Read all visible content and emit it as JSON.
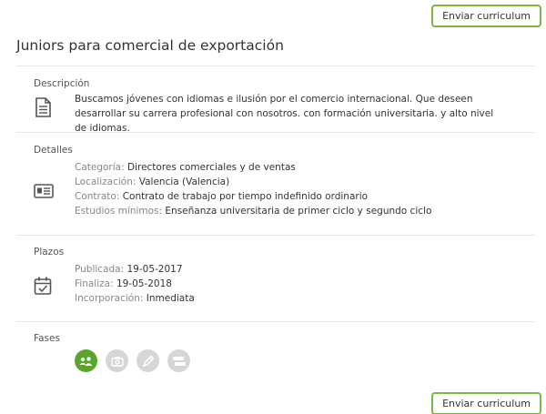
{
  "actions": {
    "send_cv_label": "Enviar curriculum"
  },
  "job": {
    "title": "Juniors para comercial de exportación"
  },
  "description": {
    "label": "Descripción",
    "text": "Buscamos jóvenes con idiomas e ilusión por el comercio internacional. Que deseen desarrollar su carrera profesional con nosotros. con formación universitaria. y alto nivel de idiomas."
  },
  "details": {
    "label": "Detalles",
    "rows": [
      {
        "key": "Categoría:",
        "value": "Directores comerciales y de ventas"
      },
      {
        "key": "Localización:",
        "value": "Valencia (Valencia)"
      },
      {
        "key": "Contrato:",
        "value": "Contrato de trabajo por tiempo indefinido ordinario"
      },
      {
        "key": "Estudios mínimos:",
        "value": "Enseñanza universitaria de primer ciclo y segundo ciclo"
      }
    ]
  },
  "deadlines": {
    "label": "Plazos",
    "rows": [
      {
        "key": "Publicada:",
        "value": "19-05-2017"
      },
      {
        "key": "Finaliza:",
        "value": "19-05-2018"
      },
      {
        "key": "Incorporación:",
        "value": "Inmediata"
      }
    ]
  },
  "phases": {
    "label": "Fases",
    "items": [
      {
        "icon": "users-icon",
        "active": true
      },
      {
        "icon": "camera-icon",
        "active": false
      },
      {
        "icon": "pencil-icon",
        "active": false
      },
      {
        "icon": "handshake-icon",
        "active": false
      }
    ]
  },
  "colors": {
    "accent": "#7ab843",
    "phase_active": "#5aa52c",
    "phase_inactive": "#d6d6d6"
  }
}
